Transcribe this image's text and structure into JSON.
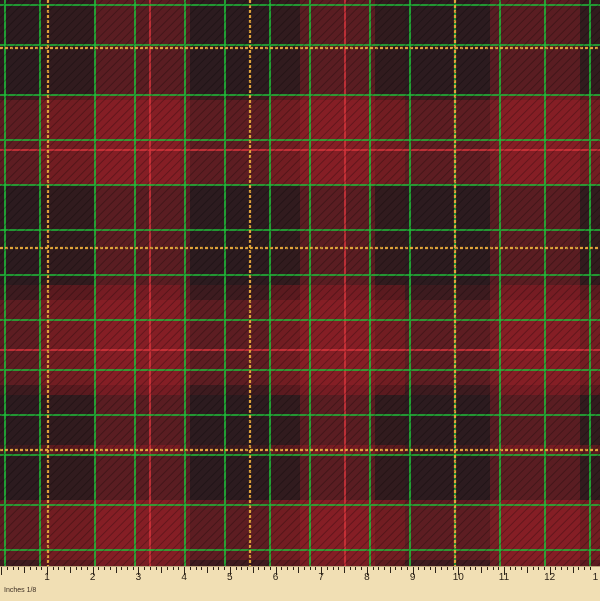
{
  "image": {
    "subject": "tartan plaid fabric swatch",
    "colors": {
      "black_band": "#2a1c1f",
      "dark_red": "#5b1a1f",
      "red": "#a8232b",
      "bright_red_stripe": "#d4343b",
      "green_grid": "#1fbf3a",
      "gold_stripe": "#e0a43a",
      "ruler_bg": "#f1dfb4",
      "ruler_ink": "#2b2218"
    }
  },
  "ruler": {
    "label": "Inches 1/8",
    "numbers": [
      "1",
      "2",
      "3",
      "4",
      "5",
      "6",
      "7",
      "8",
      "9",
      "10",
      "11",
      "12",
      "1"
    ]
  }
}
